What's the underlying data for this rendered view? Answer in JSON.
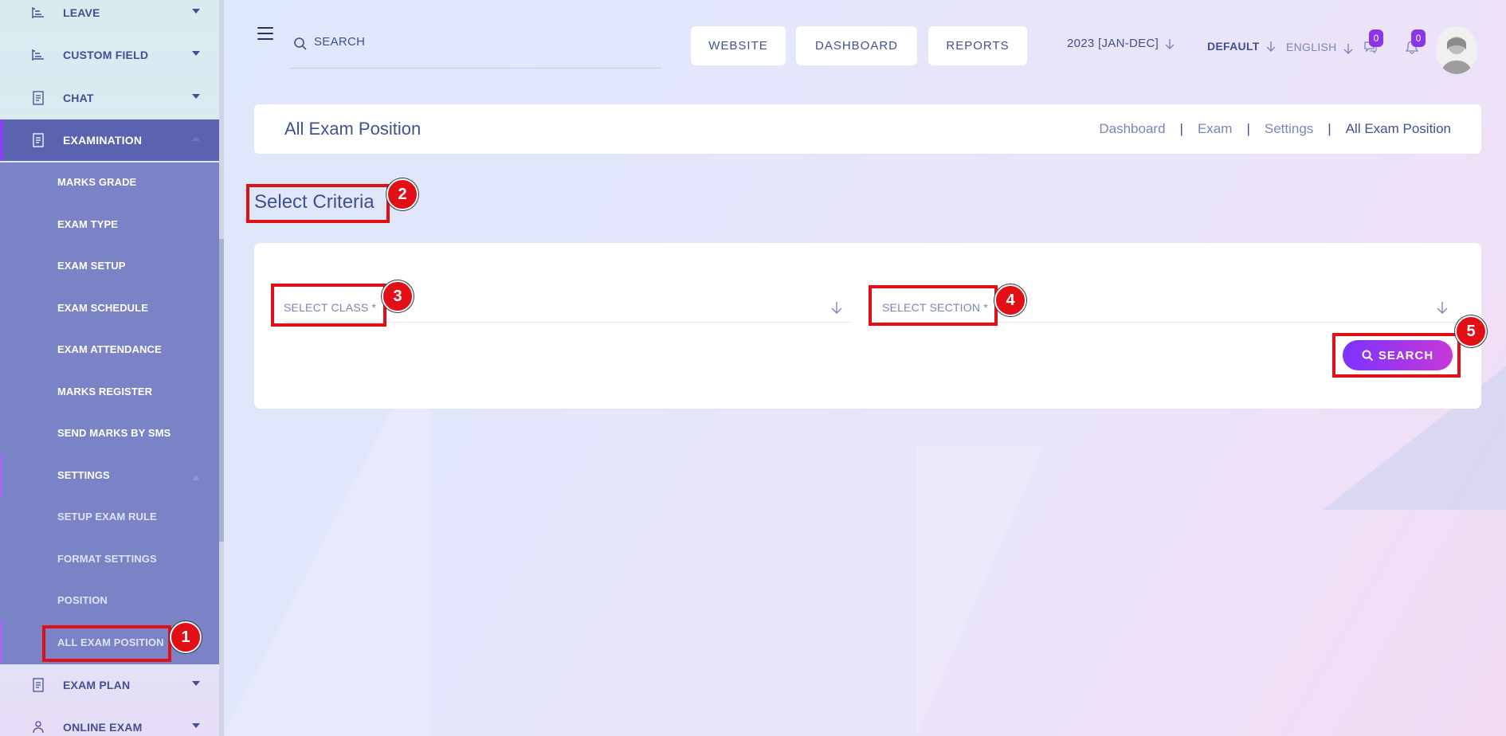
{
  "sidebar": {
    "items": [
      {
        "label": "LEAVE",
        "icon": "leave-icon"
      },
      {
        "label": "CUSTOM FIELD",
        "icon": "custom-field-icon"
      },
      {
        "label": "CHAT",
        "icon": "chat-icon"
      },
      {
        "label": "EXAMINATION",
        "icon": "examination-icon"
      },
      {
        "label": "EXAM PLAN",
        "icon": "exam-plan-icon"
      },
      {
        "label": "ONLINE EXAM",
        "icon": "online-exam-icon"
      }
    ],
    "examination_submenu": [
      "MARKS GRADE",
      "EXAM TYPE",
      "EXAM SETUP",
      "EXAM SCHEDULE",
      "EXAM ATTENDANCE",
      "MARKS REGISTER",
      "SEND MARKS BY SMS",
      "SETTINGS",
      "SETUP EXAM RULE",
      "FORMAT SETTINGS",
      "POSITION",
      "ALL EXAM POSITION"
    ]
  },
  "header": {
    "search_placeholder": "SEARCH",
    "buttons": [
      "WEBSITE",
      "DASHBOARD",
      "REPORTS"
    ],
    "session": "2023 [JAN-DEC]",
    "theme": "DEFAULT",
    "language": "ENGLISH",
    "chat_count": "0",
    "notification_count": "0"
  },
  "page": {
    "title": "All Exam Position",
    "breadcrumb": [
      "Dashboard",
      "Exam",
      "Settings",
      "All Exam Position"
    ],
    "breadcrumb_sep": "|",
    "section_title": "Select Criteria"
  },
  "form": {
    "class_placeholder": "SELECT CLASS *",
    "section_placeholder": "SELECT SECTION *",
    "search_label": "SEARCH"
  },
  "annotations": [
    "1",
    "2",
    "3",
    "4",
    "5"
  ],
  "colors": {
    "accent": "#415094",
    "highlight": "#e30f17",
    "button_gradient_start": "#7c32ff",
    "button_gradient_end": "#c738d8",
    "badge": "#8a36e8"
  }
}
